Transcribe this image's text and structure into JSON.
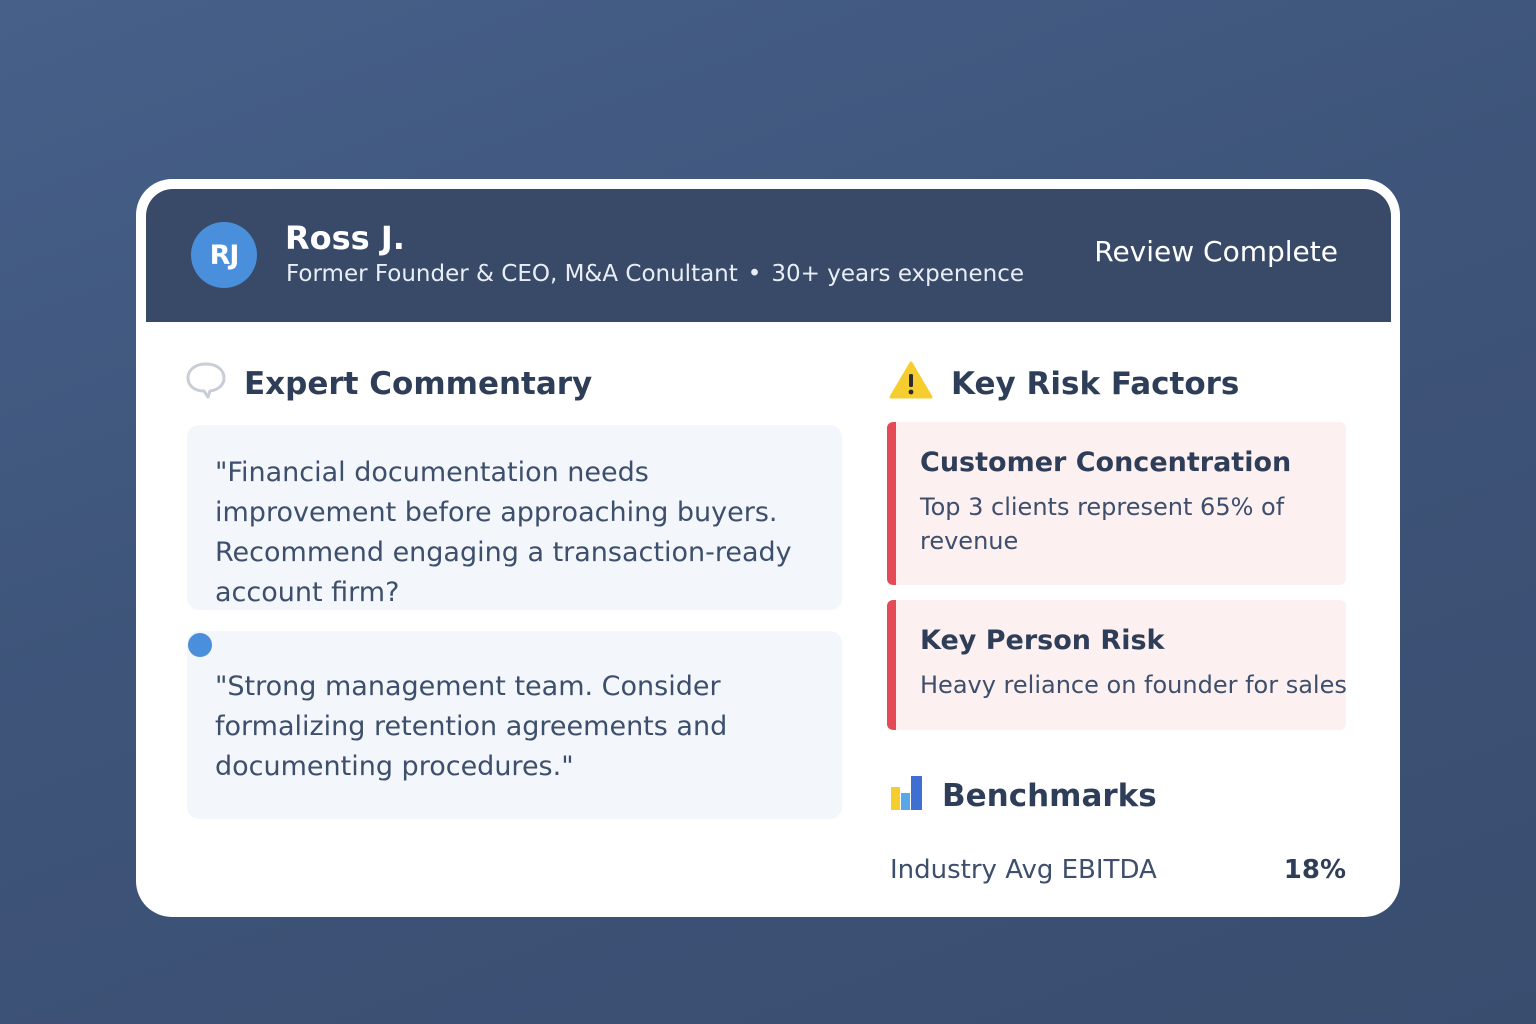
{
  "expert": {
    "initials": "RJ",
    "name": "Ross J.",
    "role": "Former Founder & CEO, M&A Conultant",
    "separator": "•",
    "experience": "30+ years expenence",
    "status": "Review Complete"
  },
  "commentary": {
    "title": "Expert Commentary",
    "icon": "speech-bubble-icon",
    "comments": [
      "\"Financial documentation needs improvement before approaching buyers. Recommend engaging a transaction-ready account firm?",
      "\"Strong management team. Consider formalizing retention agreements and documenting procedures.\""
    ]
  },
  "risks": {
    "title": "Key Risk Factors",
    "icon": "warning-icon",
    "items": [
      {
        "title": "Customer Concentration",
        "description": "Top 3 clients represent 65% of revenue"
      },
      {
        "title": "Key Person Risk",
        "description": "Heavy reliance on founder for sales"
      }
    ]
  },
  "benchmarks": {
    "title": "Benchmarks",
    "icon": "bar-chart-icon",
    "rows": [
      {
        "label": "Industry Avg EBITDA",
        "value": "18%"
      }
    ]
  },
  "colors": {
    "background": "#42597f",
    "header": "#384a68",
    "avatar": "#4a8fdb",
    "risk_accent": "#e44b55",
    "risk_bg": "#fdf0f0",
    "comment_bg": "#f3f6fa",
    "text_dark": "#2f3e58"
  }
}
